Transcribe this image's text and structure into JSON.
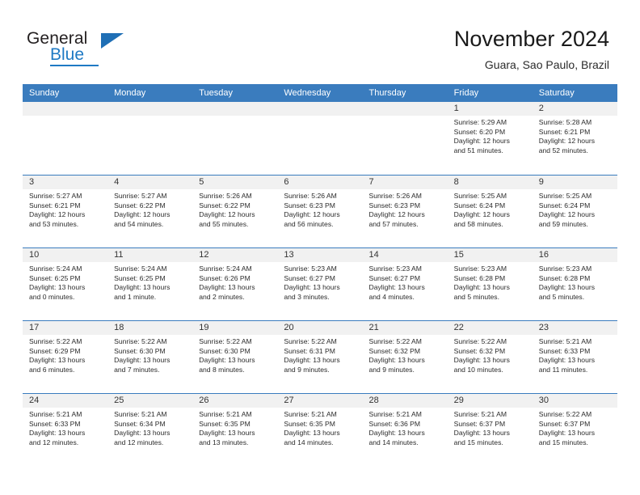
{
  "logo": {
    "word_top": "General",
    "word_bottom": "Blue",
    "triangle_color": "#1f6fb5",
    "blue_color": "#1f7ac4"
  },
  "header": {
    "title": "November 2024",
    "subtitle": "Guara, Sao Paulo, Brazil"
  },
  "theme": {
    "header_blue": "#3a7cbe",
    "daynum_band": "#f1f1f1",
    "text": "#2b2b2b"
  },
  "weekdays": [
    "Sunday",
    "Monday",
    "Tuesday",
    "Wednesday",
    "Thursday",
    "Friday",
    "Saturday"
  ],
  "labels": {
    "sunrise_prefix": "Sunrise:",
    "sunset_prefix": "Sunset:",
    "daylight_prefix": "Daylight:"
  },
  "weeks": [
    [
      {
        "day": "",
        "sunrise": "",
        "sunset": "",
        "daylight_line1": "",
        "daylight_line2": ""
      },
      {
        "day": "",
        "sunrise": "",
        "sunset": "",
        "daylight_line1": "",
        "daylight_line2": ""
      },
      {
        "day": "",
        "sunrise": "",
        "sunset": "",
        "daylight_line1": "",
        "daylight_line2": ""
      },
      {
        "day": "",
        "sunrise": "",
        "sunset": "",
        "daylight_line1": "",
        "daylight_line2": ""
      },
      {
        "day": "",
        "sunrise": "",
        "sunset": "",
        "daylight_line1": "",
        "daylight_line2": ""
      },
      {
        "day": "1",
        "sunrise": "Sunrise: 5:29 AM",
        "sunset": "Sunset: 6:20 PM",
        "daylight_line1": "Daylight: 12 hours",
        "daylight_line2": "and 51 minutes."
      },
      {
        "day": "2",
        "sunrise": "Sunrise: 5:28 AM",
        "sunset": "Sunset: 6:21 PM",
        "daylight_line1": "Daylight: 12 hours",
        "daylight_line2": "and 52 minutes."
      }
    ],
    [
      {
        "day": "3",
        "sunrise": "Sunrise: 5:27 AM",
        "sunset": "Sunset: 6:21 PM",
        "daylight_line1": "Daylight: 12 hours",
        "daylight_line2": "and 53 minutes."
      },
      {
        "day": "4",
        "sunrise": "Sunrise: 5:27 AM",
        "sunset": "Sunset: 6:22 PM",
        "daylight_line1": "Daylight: 12 hours",
        "daylight_line2": "and 54 minutes."
      },
      {
        "day": "5",
        "sunrise": "Sunrise: 5:26 AM",
        "sunset": "Sunset: 6:22 PM",
        "daylight_line1": "Daylight: 12 hours",
        "daylight_line2": "and 55 minutes."
      },
      {
        "day": "6",
        "sunrise": "Sunrise: 5:26 AM",
        "sunset": "Sunset: 6:23 PM",
        "daylight_line1": "Daylight: 12 hours",
        "daylight_line2": "and 56 minutes."
      },
      {
        "day": "7",
        "sunrise": "Sunrise: 5:26 AM",
        "sunset": "Sunset: 6:23 PM",
        "daylight_line1": "Daylight: 12 hours",
        "daylight_line2": "and 57 minutes."
      },
      {
        "day": "8",
        "sunrise": "Sunrise: 5:25 AM",
        "sunset": "Sunset: 6:24 PM",
        "daylight_line1": "Daylight: 12 hours",
        "daylight_line2": "and 58 minutes."
      },
      {
        "day": "9",
        "sunrise": "Sunrise: 5:25 AM",
        "sunset": "Sunset: 6:24 PM",
        "daylight_line1": "Daylight: 12 hours",
        "daylight_line2": "and 59 minutes."
      }
    ],
    [
      {
        "day": "10",
        "sunrise": "Sunrise: 5:24 AM",
        "sunset": "Sunset: 6:25 PM",
        "daylight_line1": "Daylight: 13 hours",
        "daylight_line2": "and 0 minutes."
      },
      {
        "day": "11",
        "sunrise": "Sunrise: 5:24 AM",
        "sunset": "Sunset: 6:25 PM",
        "daylight_line1": "Daylight: 13 hours",
        "daylight_line2": "and 1 minute."
      },
      {
        "day": "12",
        "sunrise": "Sunrise: 5:24 AM",
        "sunset": "Sunset: 6:26 PM",
        "daylight_line1": "Daylight: 13 hours",
        "daylight_line2": "and 2 minutes."
      },
      {
        "day": "13",
        "sunrise": "Sunrise: 5:23 AM",
        "sunset": "Sunset: 6:27 PM",
        "daylight_line1": "Daylight: 13 hours",
        "daylight_line2": "and 3 minutes."
      },
      {
        "day": "14",
        "sunrise": "Sunrise: 5:23 AM",
        "sunset": "Sunset: 6:27 PM",
        "daylight_line1": "Daylight: 13 hours",
        "daylight_line2": "and 4 minutes."
      },
      {
        "day": "15",
        "sunrise": "Sunrise: 5:23 AM",
        "sunset": "Sunset: 6:28 PM",
        "daylight_line1": "Daylight: 13 hours",
        "daylight_line2": "and 5 minutes."
      },
      {
        "day": "16",
        "sunrise": "Sunrise: 5:23 AM",
        "sunset": "Sunset: 6:28 PM",
        "daylight_line1": "Daylight: 13 hours",
        "daylight_line2": "and 5 minutes."
      }
    ],
    [
      {
        "day": "17",
        "sunrise": "Sunrise: 5:22 AM",
        "sunset": "Sunset: 6:29 PM",
        "daylight_line1": "Daylight: 13 hours",
        "daylight_line2": "and 6 minutes."
      },
      {
        "day": "18",
        "sunrise": "Sunrise: 5:22 AM",
        "sunset": "Sunset: 6:30 PM",
        "daylight_line1": "Daylight: 13 hours",
        "daylight_line2": "and 7 minutes."
      },
      {
        "day": "19",
        "sunrise": "Sunrise: 5:22 AM",
        "sunset": "Sunset: 6:30 PM",
        "daylight_line1": "Daylight: 13 hours",
        "daylight_line2": "and 8 minutes."
      },
      {
        "day": "20",
        "sunrise": "Sunrise: 5:22 AM",
        "sunset": "Sunset: 6:31 PM",
        "daylight_line1": "Daylight: 13 hours",
        "daylight_line2": "and 9 minutes."
      },
      {
        "day": "21",
        "sunrise": "Sunrise: 5:22 AM",
        "sunset": "Sunset: 6:32 PM",
        "daylight_line1": "Daylight: 13 hours",
        "daylight_line2": "and 9 minutes."
      },
      {
        "day": "22",
        "sunrise": "Sunrise: 5:22 AM",
        "sunset": "Sunset: 6:32 PM",
        "daylight_line1": "Daylight: 13 hours",
        "daylight_line2": "and 10 minutes."
      },
      {
        "day": "23",
        "sunrise": "Sunrise: 5:21 AM",
        "sunset": "Sunset: 6:33 PM",
        "daylight_line1": "Daylight: 13 hours",
        "daylight_line2": "and 11 minutes."
      }
    ],
    [
      {
        "day": "24",
        "sunrise": "Sunrise: 5:21 AM",
        "sunset": "Sunset: 6:33 PM",
        "daylight_line1": "Daylight: 13 hours",
        "daylight_line2": "and 12 minutes."
      },
      {
        "day": "25",
        "sunrise": "Sunrise: 5:21 AM",
        "sunset": "Sunset: 6:34 PM",
        "daylight_line1": "Daylight: 13 hours",
        "daylight_line2": "and 12 minutes."
      },
      {
        "day": "26",
        "sunrise": "Sunrise: 5:21 AM",
        "sunset": "Sunset: 6:35 PM",
        "daylight_line1": "Daylight: 13 hours",
        "daylight_line2": "and 13 minutes."
      },
      {
        "day": "27",
        "sunrise": "Sunrise: 5:21 AM",
        "sunset": "Sunset: 6:35 PM",
        "daylight_line1": "Daylight: 13 hours",
        "daylight_line2": "and 14 minutes."
      },
      {
        "day": "28",
        "sunrise": "Sunrise: 5:21 AM",
        "sunset": "Sunset: 6:36 PM",
        "daylight_line1": "Daylight: 13 hours",
        "daylight_line2": "and 14 minutes."
      },
      {
        "day": "29",
        "sunrise": "Sunrise: 5:21 AM",
        "sunset": "Sunset: 6:37 PM",
        "daylight_line1": "Daylight: 13 hours",
        "daylight_line2": "and 15 minutes."
      },
      {
        "day": "30",
        "sunrise": "Sunrise: 5:22 AM",
        "sunset": "Sunset: 6:37 PM",
        "daylight_line1": "Daylight: 13 hours",
        "daylight_line2": "and 15 minutes."
      }
    ]
  ]
}
